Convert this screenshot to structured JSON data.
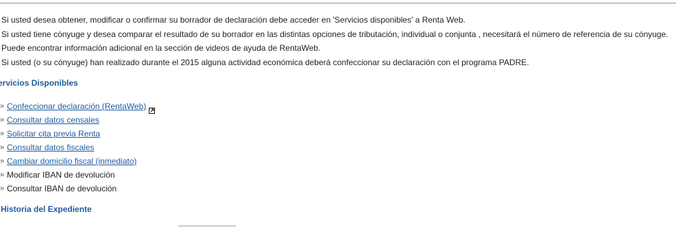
{
  "intro": {
    "line1": "Si usted desea obtener, modificar o confirmar su borrador de declaración debe acceder en 'Servicios disponibles' a Renta Web.",
    "line2": "Si usted tiene cónyuge y desea comparar el resultado de su borrador en las distintas opciones de tributación, individual o conjunta , necesitará el número de referencia de su cónyuge.",
    "line3": "Puede encontrar información adicional en la sección de videos de ayuda de RentaWeb.",
    "line4": "Si usted (o su cónyuge) han realizado durante el 2015 alguna actividad económica deberá confeccionar su declaración con el programa PADRE."
  },
  "services": {
    "title": "ervicios Disponibles",
    "bullet": "»",
    "items": [
      {
        "label": "Confeccionar declaración (RentaWeb)",
        "link": true,
        "external_icon": "external-link-icon"
      },
      {
        "label": "Consultar datos censales",
        "link": true
      },
      {
        "label": "Solicitar cita previa Renta",
        "link": true
      },
      {
        "label": "Consultar datos fiscales",
        "link": true
      },
      {
        "label": "Cambiar domicilio fiscal (inmediato)",
        "link": true
      },
      {
        "label": "Modificar IBAN de devolución",
        "link": false
      },
      {
        "label": "Consultar IBAN de devolución",
        "link": false
      }
    ]
  },
  "history": {
    "title": "Historia del Expediente"
  },
  "colors": {
    "link": "#1f5b9e",
    "text": "#222222",
    "rule": "#8a8a8a"
  }
}
